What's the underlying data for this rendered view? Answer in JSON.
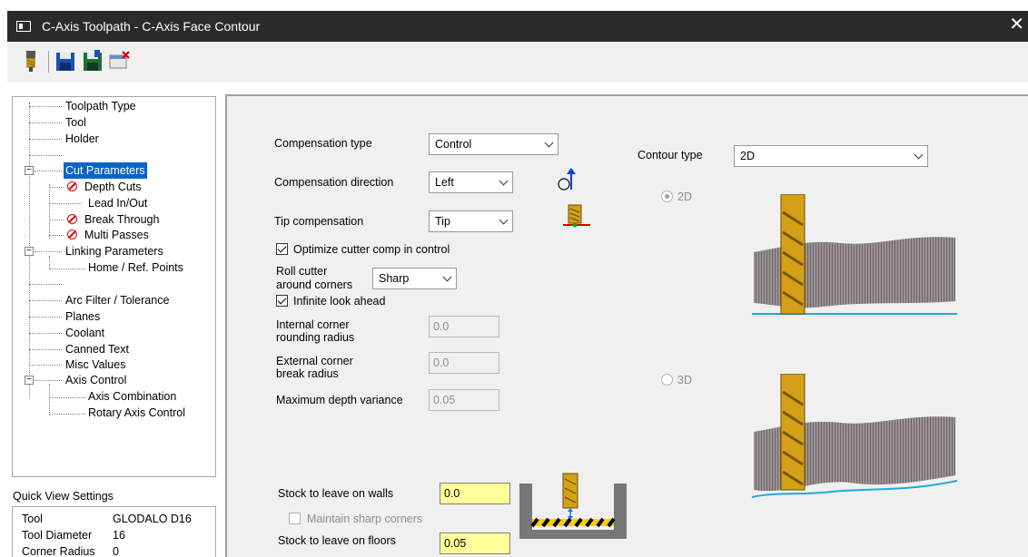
{
  "window": {
    "title": "C-Axis Toolpath - C-Axis Face Contour",
    "close_glyph": "✕"
  },
  "toolbar": {
    "buttons": [
      "tool-icon",
      "save-icon",
      "save-as-icon",
      "cancel-icon"
    ]
  },
  "tree": {
    "items": [
      {
        "label": "Toolpath Type"
      },
      {
        "label": "Tool"
      },
      {
        "label": "Holder"
      },
      {
        "label": ""
      },
      {
        "label": "Cut Parameters",
        "selected": true
      },
      {
        "label": "Depth Cuts",
        "error": true
      },
      {
        "label": "Lead In/Out"
      },
      {
        "label": "Break Through",
        "error": true
      },
      {
        "label": "Multi Passes",
        "error": true
      },
      {
        "label": "Linking Parameters"
      },
      {
        "label": "Home / Ref. Points"
      },
      {
        "label": ""
      },
      {
        "label": "Arc Filter / Tolerance"
      },
      {
        "label": "Planes"
      },
      {
        "label": "Coolant"
      },
      {
        "label": "Canned Text"
      },
      {
        "label": "Misc Values"
      },
      {
        "label": "Axis Control"
      },
      {
        "label": "Axis Combination"
      },
      {
        "label": "Rotary Axis Control"
      }
    ],
    "expander_minus": "−"
  },
  "quick_view": {
    "title": "Quick View Settings",
    "rows": [
      {
        "key": "Tool",
        "value": "GLODALO D16"
      },
      {
        "key": "Tool Diameter",
        "value": "16"
      },
      {
        "key": "Corner Radius",
        "value": "0"
      }
    ]
  },
  "form": {
    "compensation_type": {
      "label": "Compensation type",
      "value": "Control"
    },
    "compensation_direction": {
      "label": "Compensation direction",
      "value": "Left"
    },
    "tip_compensation": {
      "label": "Tip compensation",
      "value": "Tip"
    },
    "optimize": {
      "label": "Optimize cutter comp in control",
      "checked": true
    },
    "roll_cutter": {
      "label_line1": "Roll cutter",
      "label_line2": "around corners",
      "value": "Sharp"
    },
    "infinite_look_ahead": {
      "label": "Infinite look ahead",
      "checked": true
    },
    "internal_corner": {
      "label_line1": "Internal corner",
      "label_line2": "rounding radius",
      "value": "0.0"
    },
    "external_corner": {
      "label_line1": "External corner",
      "label_line2": "break radius",
      "value": "0.0"
    },
    "max_depth_variance": {
      "label": "Maximum depth variance",
      "value": "0.05"
    },
    "stock_walls": {
      "label": "Stock to leave on walls",
      "value": "0.0"
    },
    "maintain_sharp": {
      "label": "Maintain sharp corners",
      "checked": false
    },
    "stock_floors": {
      "label": "Stock to leave on floors",
      "value": "0.05"
    }
  },
  "contour": {
    "label": "Contour type",
    "value": "2D",
    "option_2d": {
      "label": "2D",
      "selected": true
    },
    "option_3d": {
      "label": "3D",
      "selected": false
    }
  },
  "colors": {
    "title_bar": "#2b2b2b",
    "selection": "#0a64c8",
    "stock_field": "#ffff99",
    "tool_gold": "#d4a017",
    "floor_line": "#1fa8e0"
  }
}
